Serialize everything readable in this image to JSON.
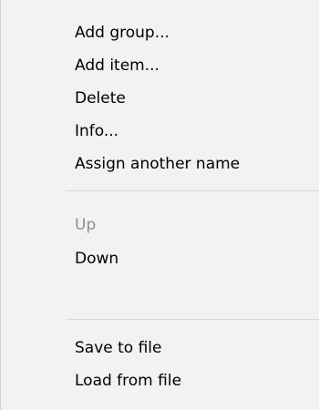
{
  "menu": {
    "items": [
      {
        "label": "Add group...",
        "enabled": true
      },
      {
        "label": "Add item...",
        "enabled": true
      },
      {
        "label": "Delete",
        "enabled": true
      },
      {
        "label": "Info...",
        "enabled": true
      },
      {
        "label": "Assign another name",
        "enabled": true
      },
      {
        "label": "Up",
        "enabled": false
      },
      {
        "label": "Down",
        "enabled": true
      },
      {
        "label": "Save to file",
        "enabled": true
      },
      {
        "label": "Load from file",
        "enabled": true
      }
    ]
  },
  "colors": {
    "background": "#f2f2f2",
    "text": "#000000",
    "disabled_text": "#8f8f8f",
    "separator": "#d7d7d7"
  }
}
